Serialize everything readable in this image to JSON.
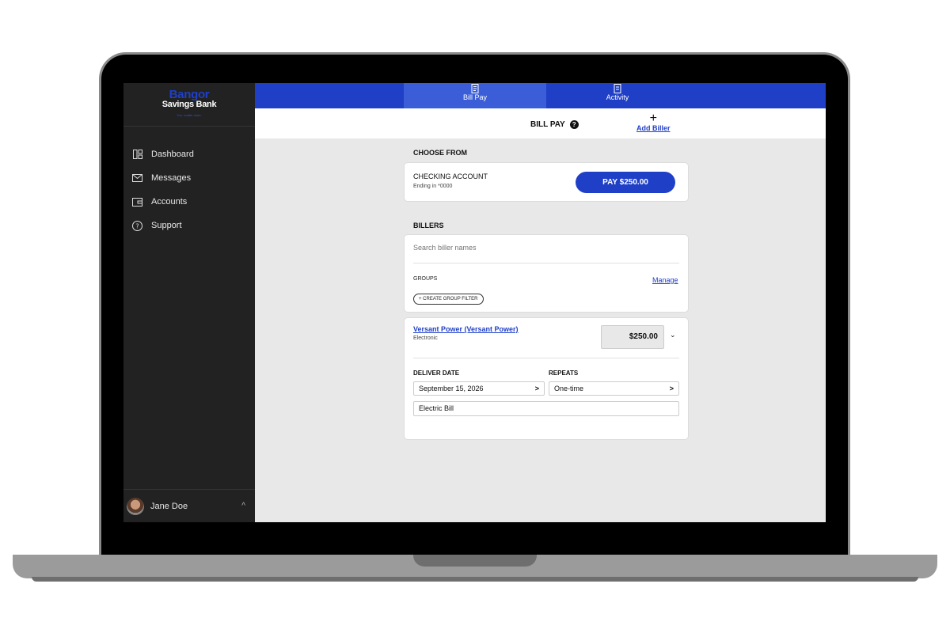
{
  "brand": {
    "name_top": "Bangor",
    "name_bottom": "Savings Bank",
    "tagline": "You. matter more."
  },
  "sidebar": {
    "items": [
      {
        "label": "Dashboard",
        "icon": "dashboard-icon"
      },
      {
        "label": "Messages",
        "icon": "envelope-icon"
      },
      {
        "label": "Accounts",
        "icon": "wallet-icon"
      },
      {
        "label": "Support",
        "icon": "question-icon"
      }
    ],
    "user": {
      "name": "Jane Doe",
      "chevron": "^"
    }
  },
  "topnav": {
    "tabs": [
      {
        "label": "Bill Pay",
        "icon": "bill-icon",
        "active": true
      },
      {
        "label": "Activity",
        "icon": "activity-icon",
        "active": false
      }
    ]
  },
  "header": {
    "title": "BILL PAY",
    "help": "?",
    "add_plus": "+",
    "add_label": "Add Biller"
  },
  "choose_from": {
    "section_label": "CHOOSE FROM",
    "account_title": "CHECKING ACCOUNT",
    "account_sub": "Ending in *0000",
    "pay_label": "PAY $250.00"
  },
  "billers": {
    "section_label": "BILLERS",
    "search_placeholder": "Search biller names",
    "groups_label": "GROUPS",
    "manage_label": "Manage",
    "create_filter_label": "+ CREATE GROUP FILTER"
  },
  "biller": {
    "name": "Versant Power (Versant Power)",
    "type": "Electronic",
    "amount": "$250.00",
    "chevron": "⌄",
    "deliver_label": "DELIVER DATE",
    "deliver_value": "September 15, 2026",
    "repeats_label": "REPEATS",
    "repeats_value": "One-time",
    "select_chevron": ">",
    "memo_value": "Electric Bill"
  },
  "colors": {
    "brand_blue": "#1f3fc7",
    "active_tab": "#3b5ed8",
    "sidebar_bg": "#222222",
    "content_bg": "#e8e8e8"
  }
}
